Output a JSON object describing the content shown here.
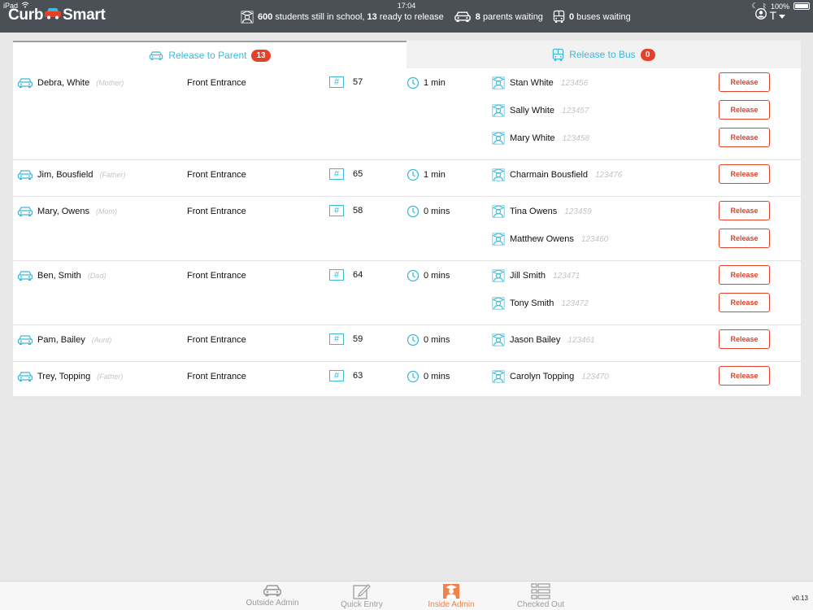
{
  "status_bar": {
    "device": "iPad",
    "time": "17:04",
    "battery": "100%"
  },
  "header": {
    "logo_left": "Curb",
    "logo_right": "Smart",
    "stats": {
      "students_count": "600",
      "students_text": "students still in school,",
      "ready_count": "13",
      "ready_text": "ready to release",
      "parents_count": "8",
      "parents_text": "parents waiting",
      "buses_count": "0",
      "buses_text": "buses waiting"
    },
    "user_initial": "T"
  },
  "tabs": [
    {
      "label": "Release to Parent",
      "badge": "13"
    },
    {
      "label": "Release to Bus",
      "badge": "0"
    }
  ],
  "release_label": "Release",
  "rows": [
    {
      "parent": "Debra, White",
      "relation": "(Mother)",
      "location": "Front Entrance",
      "spot": "57",
      "wait": "1 min",
      "students": [
        {
          "name": "Stan White",
          "id": "123456"
        },
        {
          "name": "Sally White",
          "id": "123457"
        },
        {
          "name": "Mary White",
          "id": "123458"
        }
      ]
    },
    {
      "parent": "Jim, Bousfield",
      "relation": "(Father)",
      "location": "Front Entrance",
      "spot": "65",
      "wait": "1 min",
      "students": [
        {
          "name": "Charmain Bousfield",
          "id": "123476"
        }
      ]
    },
    {
      "parent": "Mary, Owens",
      "relation": "(Mom)",
      "location": "Front Entrance",
      "spot": "58",
      "wait": "0 mins",
      "students": [
        {
          "name": "Tina Owens",
          "id": "123459"
        },
        {
          "name": "Matthew Owens",
          "id": "123460"
        }
      ]
    },
    {
      "parent": "Ben, Smith",
      "relation": "(Dad)",
      "location": "Front Entrance",
      "spot": "64",
      "wait": "0 mins",
      "students": [
        {
          "name": "Jill Smith",
          "id": "123471"
        },
        {
          "name": "Tony Smith",
          "id": "123472"
        }
      ]
    },
    {
      "parent": "Pam, Bailey",
      "relation": "(Aunt)",
      "location": "Front Entrance",
      "spot": "59",
      "wait": "0 mins",
      "students": [
        {
          "name": "Jason Bailey",
          "id": "123461"
        }
      ]
    },
    {
      "parent": "Trey, Topping",
      "relation": "(Father)",
      "location": "Front Entrance",
      "spot": "63",
      "wait": "0 mins",
      "students": [
        {
          "name": "Carolyn Topping",
          "id": "123470"
        }
      ]
    }
  ],
  "bottom_nav": [
    {
      "label": "Outside Admin",
      "icon": "car-icon",
      "active": false
    },
    {
      "label": "Quick Entry",
      "icon": "edit-icon",
      "active": false
    },
    {
      "label": "Inside Admin",
      "icon": "graduate-icon",
      "active": true
    },
    {
      "label": "Checked Out",
      "icon": "list-icon",
      "active": false
    }
  ],
  "version": "v0.13",
  "colors": {
    "accent": "#3fb9da",
    "danger": "#e4412b",
    "header_bg": "#4b4f56",
    "active_nav": "#f0824a"
  }
}
